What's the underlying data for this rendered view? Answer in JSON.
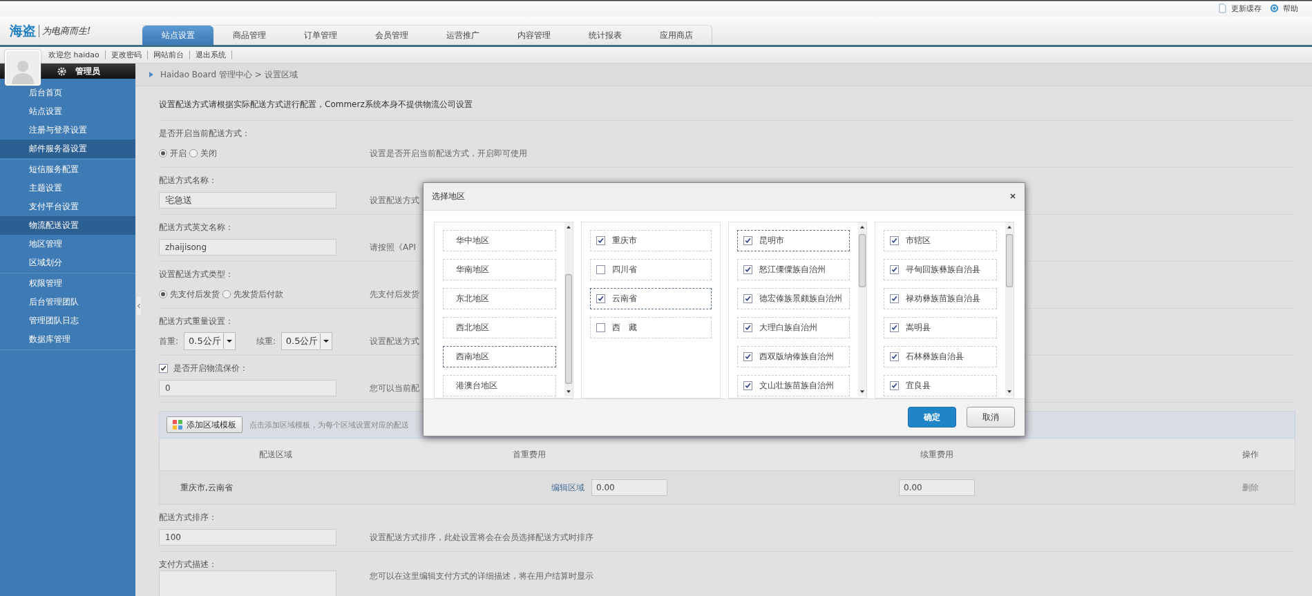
{
  "top_links": [
    {
      "label": "更新缓存"
    },
    {
      "label": "帮助"
    }
  ],
  "logo": {
    "name": "海盗",
    "slogan": "为电商而生!"
  },
  "tabs": [
    {
      "label": "站点设置",
      "selected": true
    },
    {
      "label": "商品管理",
      "selected": false
    },
    {
      "label": "订单管理",
      "selected": false
    },
    {
      "label": "会员管理",
      "selected": false
    },
    {
      "label": "运营推广",
      "selected": false
    },
    {
      "label": "内容管理",
      "selected": false
    },
    {
      "label": "统计报表",
      "selected": false
    },
    {
      "label": "应用商店",
      "selected": false
    }
  ],
  "user_bar": [
    "欢迎您 haidao",
    "更改密码",
    "网站前台",
    "退出系统"
  ],
  "sidebar": {
    "role": "管理员",
    "groups": [
      [
        {
          "label": "后台首页",
          "selected": false
        },
        {
          "label": "站点设置",
          "selected": false
        },
        {
          "label": "注册与登录设置",
          "selected": false
        },
        {
          "label": "邮件服务器设置",
          "selected": true
        }
      ],
      [
        {
          "label": "短信服务配置",
          "selected": false
        },
        {
          "label": "主题设置",
          "selected": false
        },
        {
          "label": "支付平台设置",
          "selected": false
        },
        {
          "label": "物流配送设置",
          "selected": true
        },
        {
          "label": "地区管理",
          "selected": false
        },
        {
          "label": "区域划分",
          "selected": false
        }
      ],
      [
        {
          "label": "权限管理",
          "selected": false
        },
        {
          "label": "后台管理团队",
          "selected": false
        },
        {
          "label": "管理团队日志",
          "selected": false
        },
        {
          "label": "数据库管理",
          "selected": false
        }
      ]
    ]
  },
  "breadcrumb": "Haidao Board 管理中心 > 设置区域",
  "notice": "设置配送方式请根据实际配送方式进行配置，Commerz系统本身不提供物流公司设置",
  "enabled": {
    "label": "是否开启当前配送方式：",
    "options": [
      {
        "label": "开启",
        "selected": true
      },
      {
        "label": "关闭",
        "selected": false
      }
    ],
    "hint": "设置是否开启当前配送方式，开启即可使用"
  },
  "name": {
    "label": "配送方式名称：",
    "value": "宅急送",
    "hint": "设置配送方式"
  },
  "english_name": {
    "label": "配送方式英文名称：",
    "value": "zhaijisong",
    "hint": "请按照《API"
  },
  "type": {
    "label": "设置配送方式类型：",
    "options": [
      {
        "label": "先支付后发货",
        "selected": true
      },
      {
        "label": "先发货后付款",
        "selected": false
      }
    ],
    "hint": "先支付后发货"
  },
  "weight": {
    "label": "配送方式重量设置：",
    "first_label": "首重:",
    "first_value": "0.5公斤",
    "next_label": "续重:",
    "next_value": "0.5公斤",
    "hint": "设置配送方式"
  },
  "insurance": {
    "label": "是否开启物流保价：",
    "checked": true,
    "value": "0",
    "hint": "您可以当前配"
  },
  "region_table": {
    "add_button": "添加区域模板",
    "hint": "点击添加区域模板，为每个区域设置对应的配送",
    "columns": [
      "配送区域",
      "首重费用",
      "续重费用",
      "操作"
    ],
    "rows": [
      {
        "region": "重庆市,云南省",
        "edit_link": "编辑区域",
        "first_fee": "0.00",
        "next_fee": "0.00",
        "action": "删除"
      }
    ]
  },
  "sort": {
    "label": "配送方式排序：",
    "value": "100",
    "hint": "设置配送方式排序，此处设置将会在会员选择配送方式时排序"
  },
  "description": {
    "label": "支付方式描述：",
    "hint": "您可以在这里编辑支付方式的详细描述，将在用户结算时显示"
  },
  "dialog": {
    "title": "选择地区",
    "columns": [
      {
        "kind": "list",
        "scrollbar": true,
        "items": [
          {
            "label": "华中地区",
            "selected": false
          },
          {
            "label": "华南地区",
            "selected": false
          },
          {
            "label": "东北地区",
            "selected": false
          },
          {
            "label": "西北地区",
            "selected": false
          },
          {
            "label": "西南地区",
            "selected": true
          },
          {
            "label": "港澳台地区",
            "selected": false
          }
        ]
      },
      {
        "kind": "checklist",
        "scrollbar": false,
        "items": [
          {
            "label": "重庆市",
            "checked": true,
            "selected": false
          },
          {
            "label": "四川省",
            "checked": false,
            "selected": false
          },
          {
            "label": "云南省",
            "checked": true,
            "selected": true
          },
          {
            "label": "西　藏",
            "checked": false,
            "selected": false
          }
        ]
      },
      {
        "kind": "checklist",
        "scrollbar": true,
        "items": [
          {
            "label": "昆明市",
            "checked": true,
            "selected": true
          },
          {
            "label": "怒江傈僳族自治州",
            "checked": true,
            "selected": false
          },
          {
            "label": "德宏傣族景颇族自治州",
            "checked": true,
            "selected": false
          },
          {
            "label": "大理白族自治州",
            "checked": true,
            "selected": false
          },
          {
            "label": "西双版纳傣族自治州",
            "checked": true,
            "selected": false
          },
          {
            "label": "文山壮族苗族自治州",
            "checked": true,
            "selected": false
          }
        ]
      },
      {
        "kind": "checklist",
        "scrollbar": true,
        "items": [
          {
            "label": "市辖区",
            "checked": true,
            "selected": false
          },
          {
            "label": "寻甸回族彝族自治县",
            "checked": true,
            "selected": false
          },
          {
            "label": "禄劝彝族苗族自治县",
            "checked": true,
            "selected": false
          },
          {
            "label": "嵩明县",
            "checked": true,
            "selected": false
          },
          {
            "label": "石林彝族自治县",
            "checked": true,
            "selected": false
          },
          {
            "label": "宜良县",
            "checked": true,
            "selected": false
          }
        ]
      }
    ],
    "buttons": [
      {
        "label": "确定",
        "primary": true
      },
      {
        "label": "取消",
        "primary": false
      }
    ]
  }
}
